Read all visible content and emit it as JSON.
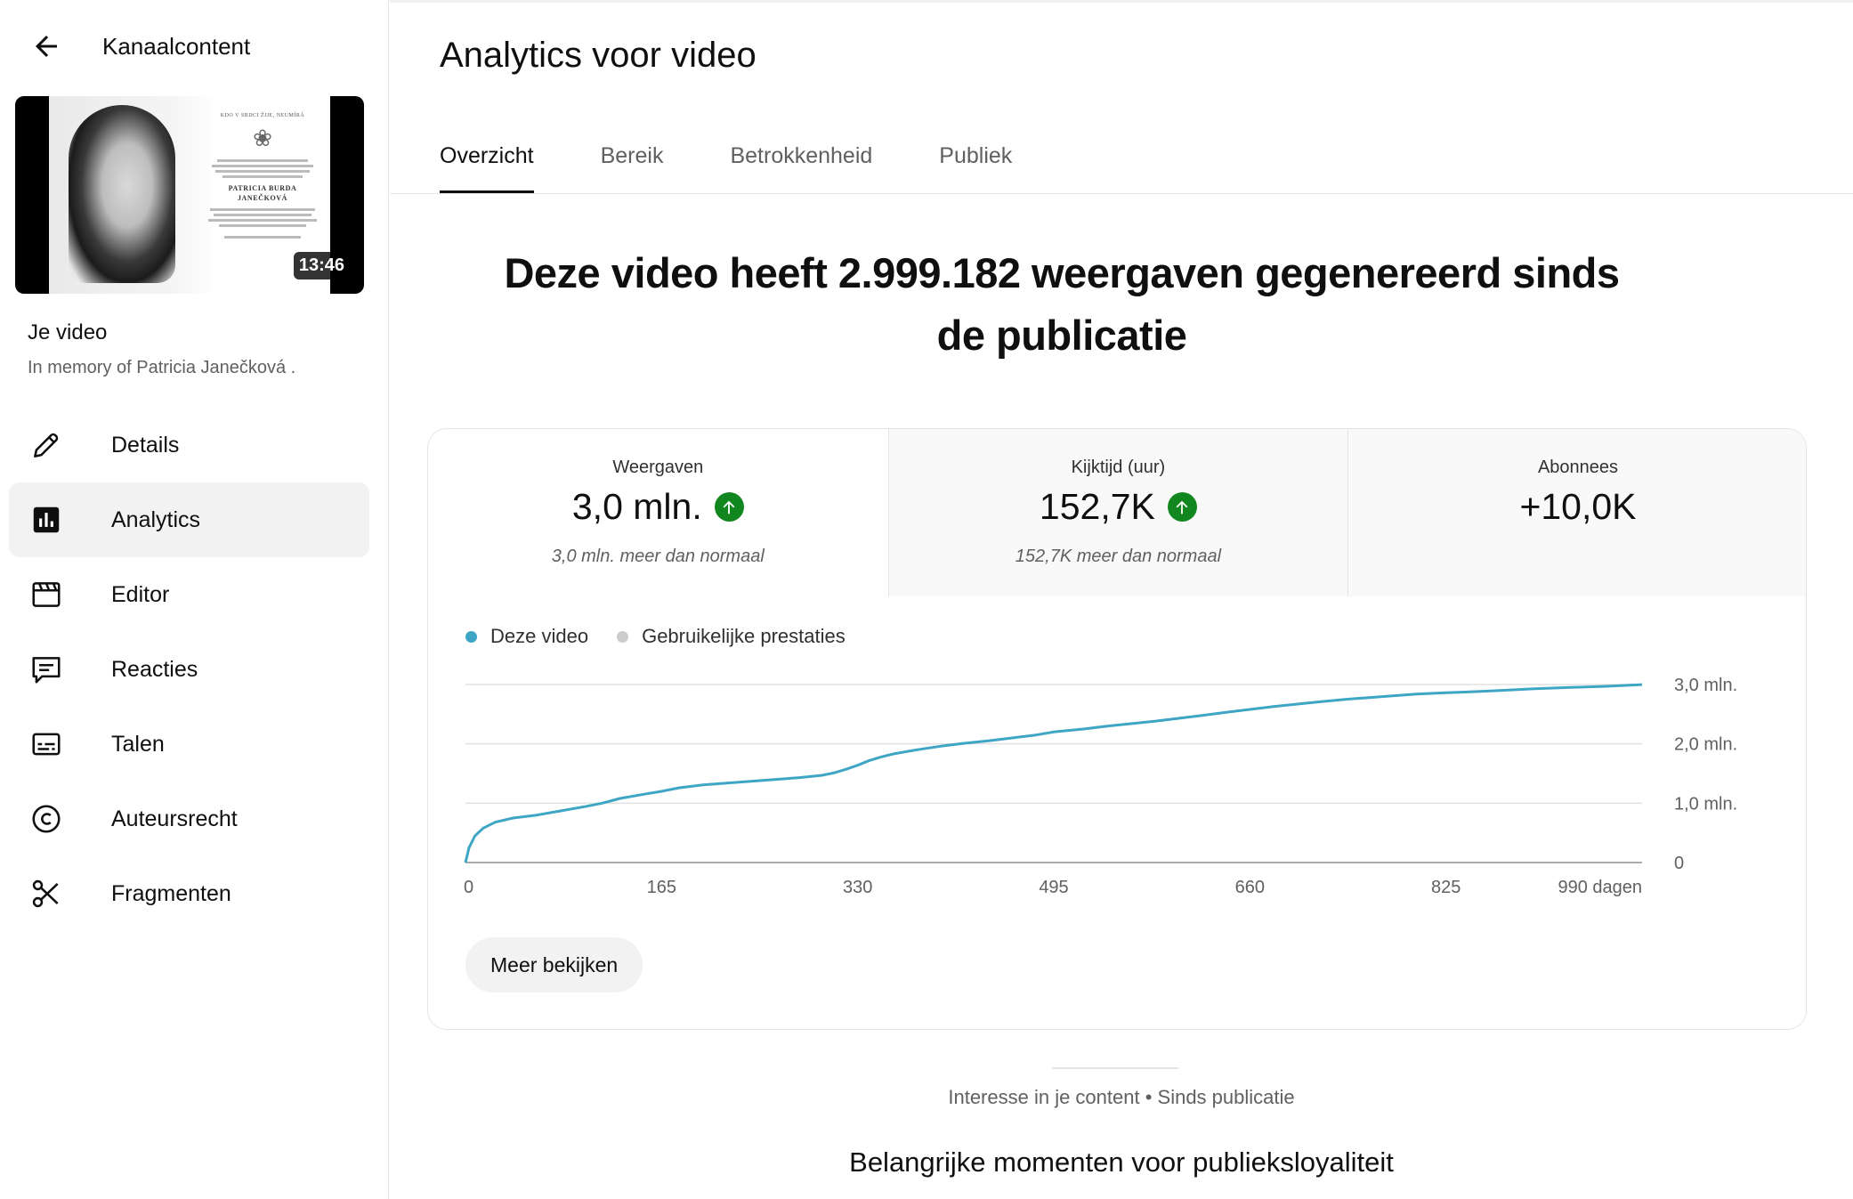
{
  "sidebar": {
    "back_title": "Kanaalcontent",
    "thumbnail": {
      "duration": "13:46",
      "card_top": "KDO V SRDCI ŽIJE, NEUMÍRÁ",
      "card_name": "PATRICIA BURDA JANEČKOVÁ"
    },
    "video_label": "Je video",
    "video_title": "In memory of Patricia Janečková .",
    "nav": [
      {
        "label": "Details",
        "icon": "pencil-icon"
      },
      {
        "label": "Analytics",
        "icon": "analytics-icon",
        "active": true
      },
      {
        "label": "Editor",
        "icon": "clapperboard-icon"
      },
      {
        "label": "Reacties",
        "icon": "comment-icon"
      },
      {
        "label": "Talen",
        "icon": "subtitles-icon"
      },
      {
        "label": "Auteursrecht",
        "icon": "copyright-icon"
      },
      {
        "label": "Fragmenten",
        "icon": "scissors-icon"
      }
    ]
  },
  "main": {
    "title": "Analytics voor video",
    "tabs": [
      {
        "label": "Overzicht",
        "active": true
      },
      {
        "label": "Bereik"
      },
      {
        "label": "Betrokkenheid"
      },
      {
        "label": "Publiek"
      }
    ],
    "headline": "Deze video heeft 2.999.182 weergaven gegenereerd sinds de publicatie",
    "metrics": [
      {
        "label": "Weergaven",
        "value": "3,0 mln.",
        "note": "3,0 mln. meer dan normaal",
        "trend": "up"
      },
      {
        "label": "Kijktijd (uur)",
        "value": "152,7K",
        "note": "152,7K meer dan normaal",
        "trend": "up"
      },
      {
        "label": "Abonnees",
        "value": "+10,0K",
        "note": ""
      }
    ],
    "legend": [
      {
        "label": "Deze video",
        "color": "#3ea6c4"
      },
      {
        "label": "Gebruikelijke prestaties",
        "color": "#cccccc"
      }
    ],
    "more_button": "Meer bekijken",
    "context_text": "Interesse in je content • Sinds publicatie",
    "section_title": "Belangrijke momenten voor publieksloyaliteit"
  },
  "chart_data": {
    "type": "line",
    "x_tick_labels": [
      "0",
      "165",
      "330",
      "495",
      "660",
      "825",
      "990 dagen"
    ],
    "x_ticks": [
      0,
      165,
      330,
      495,
      660,
      825,
      990
    ],
    "y_tick_labels": [
      "0",
      "1,0 mln.",
      "2,0 mln.",
      "3,0 mln."
    ],
    "y_ticks": [
      0,
      1000000,
      2000000,
      3000000
    ],
    "xlim": [
      0,
      990
    ],
    "ylim": [
      0,
      3000000
    ],
    "grid": true,
    "series": [
      {
        "name": "Deze video",
        "color": "#3ea6c4",
        "x": [
          0,
          3,
          8,
          15,
          25,
          40,
          60,
          80,
          100,
          115,
          130,
          150,
          165,
          180,
          200,
          220,
          240,
          260,
          280,
          300,
          310,
          320,
          330,
          340,
          350,
          360,
          380,
          400,
          420,
          440,
          460,
          480,
          495,
          520,
          540,
          560,
          580,
          600,
          620,
          640,
          660,
          680,
          700,
          720,
          740,
          760,
          780,
          800,
          825,
          850,
          870,
          900,
          930,
          960,
          980,
          990
        ],
        "values": [
          0,
          250000,
          450000,
          580000,
          680000,
          750000,
          800000,
          870000,
          940000,
          1000000,
          1080000,
          1150000,
          1200000,
          1260000,
          1310000,
          1340000,
          1370000,
          1400000,
          1430000,
          1470000,
          1510000,
          1570000,
          1640000,
          1720000,
          1780000,
          1830000,
          1900000,
          1960000,
          2010000,
          2050000,
          2100000,
          2150000,
          2200000,
          2250000,
          2300000,
          2340000,
          2380000,
          2430000,
          2480000,
          2530000,
          2580000,
          2630000,
          2670000,
          2710000,
          2750000,
          2780000,
          2810000,
          2840000,
          2860000,
          2880000,
          2900000,
          2930000,
          2950000,
          2970000,
          2990000,
          2999182
        ]
      }
    ]
  }
}
